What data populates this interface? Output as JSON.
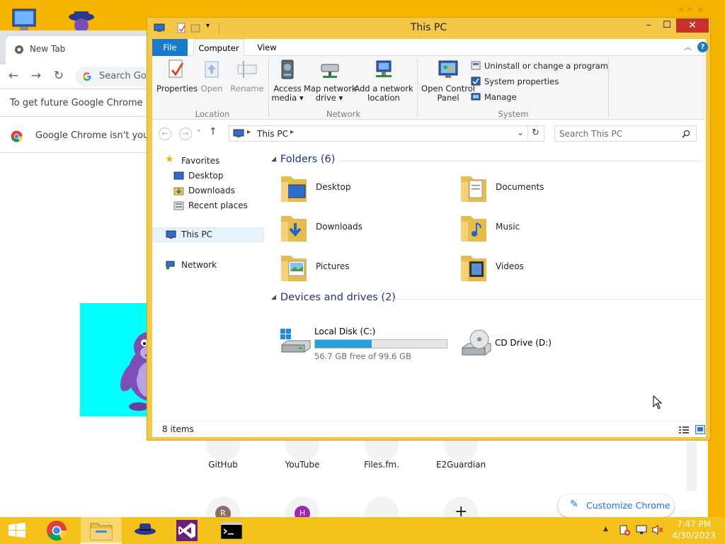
{
  "chrome": {
    "tab_title": "New Tab",
    "omnibox_placeholder": "Search Goo",
    "update_text": "To get future Google Chrome upd",
    "default_text": "Google Chrome isn't your d",
    "shortcuts": [
      {
        "label": "GitHub"
      },
      {
        "label": "YouTube"
      },
      {
        "label": "Files.fm."
      },
      {
        "label": "E2Guardian"
      }
    ],
    "shortcut_letters": [
      "R",
      "H"
    ],
    "customize_label": "Customize Chrome"
  },
  "explorer": {
    "title": "This PC",
    "ribbon_tabs": [
      "File",
      "Computer",
      "View"
    ],
    "location_group": {
      "label": "Location",
      "buttons": [
        "Properties",
        "Open",
        "Rename"
      ]
    },
    "network_group": {
      "label": "Network",
      "access_media": [
        "Access",
        "media"
      ],
      "map_drive": [
        "Map network",
        "drive"
      ],
      "add_location": [
        "Add a network",
        "location"
      ]
    },
    "system_group": {
      "label": "System",
      "control_panel": [
        "Open Control",
        "Panel"
      ],
      "items": [
        "Uninstall or change a program",
        "System properties",
        "Manage"
      ]
    },
    "address": "This PC",
    "search_placeholder": "Search This PC",
    "nav": {
      "favorites": "Favorites",
      "desktop": "Desktop",
      "downloads": "Downloads",
      "recent": "Recent places",
      "thispc": "This PC",
      "network": "Network"
    },
    "folders_header": "Folders (6)",
    "folders": [
      "Desktop",
      "Documents",
      "Downloads",
      "Music",
      "Pictures",
      "Videos"
    ],
    "devices_header": "Devices and drives (2)",
    "drives": [
      {
        "name": "Local Disk (C:)",
        "free_text": "56.7 GB free of 99.6 GB",
        "used_fraction": 0.43
      },
      {
        "name": "CD Drive (D:)"
      }
    ],
    "status_text": "8 items"
  },
  "taskbar": {
    "time": "7:47 PM",
    "date": "4/30/2023"
  },
  "colors": {
    "desktop": "#f6b400",
    "file_tab": "#1979ca",
    "close_button": "#c7312c",
    "drive_fill": "#26a0da",
    "bonzi_bg": "#00ffff"
  }
}
